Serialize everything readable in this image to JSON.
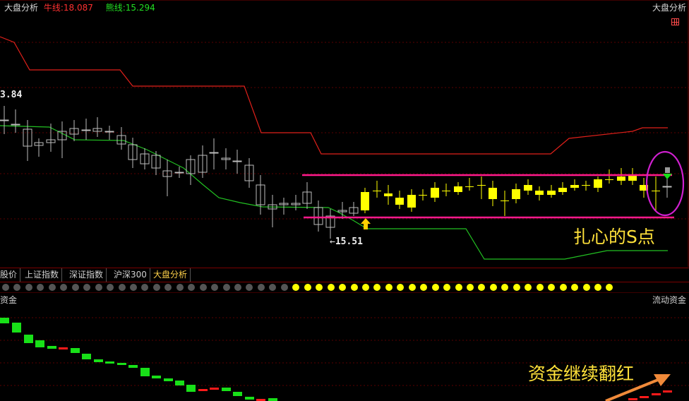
{
  "header": {
    "indicator_name": "大盘分析",
    "bull_label": "牛线:",
    "bull_value": "18.087",
    "bear_label": "熊线:",
    "bear_value": "15.294",
    "right_label": "大盘分析"
  },
  "price_labels": {
    "high": "3.84",
    "low": "15.51",
    "low_arrow": "←"
  },
  "annotations": {
    "s_point": "扎心的S点",
    "funds_red": "资金继续翻红"
  },
  "tabs": [
    {
      "label": "股价",
      "active": false
    },
    {
      "label": "上证指数",
      "active": false
    },
    {
      "label": "深证指数",
      "active": false
    },
    {
      "label": "沪深300",
      "active": false
    },
    {
      "label": "大盘分析",
      "active": true
    }
  ],
  "lower_panel": {
    "left_label": "资金",
    "right_label": "流动资金"
  },
  "colors": {
    "bull_line": "#e0201a",
    "bear_line": "#22c022",
    "up_candle": "#ffff00",
    "down_candle": "#bdbdbd",
    "range_line": "#ff1a8c",
    "circle": "#d020d0",
    "annotation_text": "#ffe13a",
    "flow_green": "#18e018",
    "flow_red": "#ff1a1a",
    "dot_gray": "#555555",
    "dot_yellow": "#ffff00"
  },
  "dots": {
    "gray_count": 25,
    "yellow_count": 28
  }
}
